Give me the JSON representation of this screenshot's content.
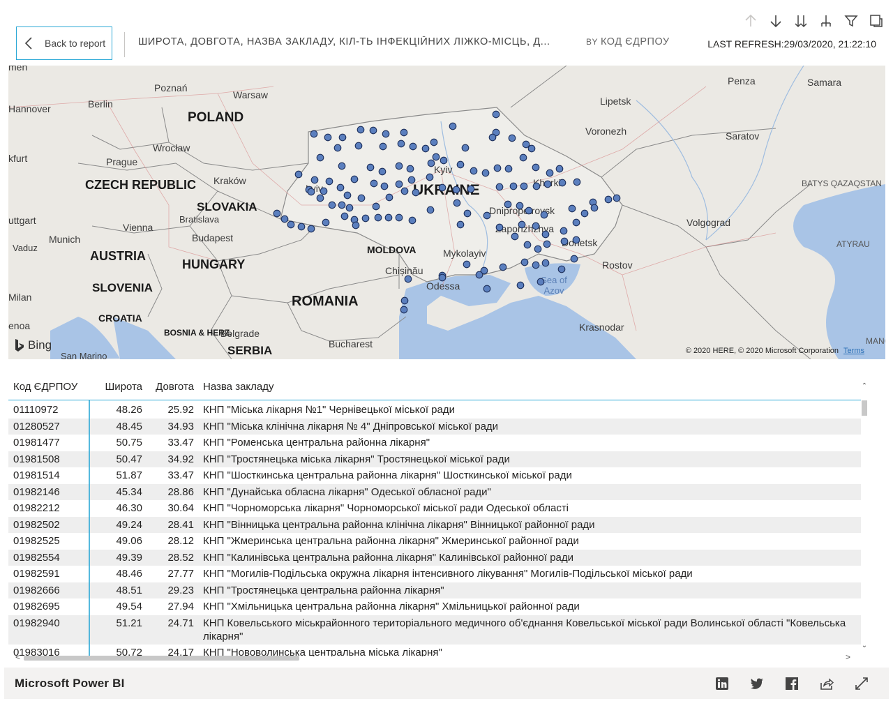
{
  "toolbar": {
    "icons": [
      "drill-up-icon",
      "drill-down-icon",
      "expand-next-level-icon",
      "expand-hierarchy-icon",
      "filter-icon",
      "focus-mode-icon"
    ]
  },
  "header": {
    "back_label": "Back to report",
    "title": "ШИРОТА, ДОВГОТА, НАЗВА ЗАКЛАДУ, КІЛ-ТЬ ІНФЕКЦІЙНИХ ЛІЖКО-МІСЦЬ, Д...",
    "by_label": "BY",
    "by_field": "КОД ЄДРПОУ",
    "last_refresh": "LAST REFRESH:29/03/2020, 21:22:10"
  },
  "map": {
    "countries": [
      "POLAND",
      "CZECH REPUBLIC",
      "SLOVAKIA",
      "AUSTRIA",
      "HUNGARY",
      "SLOVENIA",
      "CROATIA",
      "ROMANIA",
      "UKRAINE",
      "MOLDOVA",
      "SERBIA"
    ],
    "small_country": "BOSNIA & HERZ.",
    "cities": [
      "Poznań",
      "Warsaw",
      "Berlin",
      "Hannover",
      "Wrocław",
      "Prague",
      "Kraków",
      "Bratislava",
      "Vienna",
      "Munich",
      "Budapest",
      "Vaduz",
      "Milan",
      "San Marino",
      "Belgrade",
      "Bucharest",
      "Chișinău",
      "Odessa",
      "Mykolayiv",
      "Kyiv",
      "Lviv",
      "Kharkiv",
      "Dnipropetrovsk",
      "Zaporizhzhya",
      "Donetsk",
      "Rostov",
      "Krasnodar",
      "Voronezh",
      "Lipetsk",
      "Penza",
      "Samara",
      "Saratov",
      "Volgograd"
    ],
    "regions": [
      "BATYS QAZAQSTAN",
      "ATYRAU",
      "MANGG"
    ],
    "sea": "Sea of Azov",
    "fragments": [
      "men",
      "kfurt",
      "uttgart",
      "enoa"
    ],
    "bing": "Bing",
    "copyright": "© 2020 HERE, © 2020 Microsoft Corporation",
    "terms": "Terms",
    "marker_color": "#5b7fbe"
  },
  "table": {
    "headers": [
      "Код ЄДРПОУ",
      "Широта",
      "Довгота",
      "Назва закладу"
    ],
    "rows": [
      [
        "01110972",
        "48.26",
        "25.92",
        "КНП \"Міська лікарня №1\" Чернівецької міської ради"
      ],
      [
        "01280527",
        "48.45",
        "34.93",
        "КНП \"Міська клінічна лікарня № 4\" Дніпровської міської ради"
      ],
      [
        "01981477",
        "50.75",
        "33.47",
        "КНП \"Роменська центральна районна лікарня\""
      ],
      [
        "01981508",
        "50.47",
        "34.92",
        "КНП \"Тростянецька міська лікарня\" Тростянецької міської ради"
      ],
      [
        "01981514",
        "51.87",
        "33.47",
        "КНП \"Шосткинська центральна районна лікарня\" Шосткинської міської ради"
      ],
      [
        "01982146",
        "45.34",
        "28.86",
        "КНП \"Дунайська обласна лікарня\" Одеської обласної ради\""
      ],
      [
        "01982212",
        "46.30",
        "30.64",
        "КНП \"Чорноморська лікарня\" Чорноморської міської ради Одеської області"
      ],
      [
        "01982502",
        "49.24",
        "28.41",
        "КНП \"Вінницька центральна районна клінічна лікарня\" Вінницької районної ради"
      ],
      [
        "01982525",
        "49.06",
        "28.12",
        "КНП \"Жмеринська центральна районна лікарня\" Жмеринської районної ради"
      ],
      [
        "01982554",
        "49.39",
        "28.52",
        "КНП \"Калинівська центральна районна лікарня\" Калинівської районної ради"
      ],
      [
        "01982591",
        "48.46",
        "27.77",
        "КНП \"Могилів-Подільська окружна лікарня інтенсивного лікування\" Могилів-Подільської міської ради"
      ],
      [
        "01982666",
        "48.51",
        "29.23",
        "КНП \"Тростянецька центральна районна лікарня\""
      ],
      [
        "01982695",
        "49.54",
        "27.94",
        "КНП \"Хмільницька центральна районна лікарня\" Хмільницької районної ради"
      ],
      [
        "01982940",
        "51.21",
        "24.71",
        "КНП Ковельського міськрайонного територіального медичного об'єднання Ковельської міської ради Волинської області \"Ковельська лікарня\""
      ],
      [
        "01983016",
        "50.72",
        "24.17",
        "КНП \"Нововолинська центральна міська лікарня\""
      ]
    ]
  },
  "footer": {
    "brand": "Microsoft Power BI",
    "icons": [
      "linkedin-icon",
      "twitter-icon",
      "facebook-icon",
      "share-icon",
      "fullscreen-icon"
    ]
  }
}
